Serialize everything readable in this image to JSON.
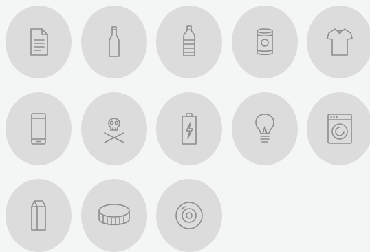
{
  "category_icons": [
    {
      "name": "paper-document",
      "icon": "document-icon"
    },
    {
      "name": "glass-bottle",
      "icon": "glass-bottle-icon"
    },
    {
      "name": "plastic-bottle",
      "icon": "plastic-bottle-icon"
    },
    {
      "name": "tin-can",
      "icon": "tin-can-icon"
    },
    {
      "name": "clothing",
      "icon": "t-shirt-icon"
    },
    {
      "name": "mobile-phone",
      "icon": "smartphone-icon"
    },
    {
      "name": "hazardous-waste",
      "icon": "skull-crossbones-icon"
    },
    {
      "name": "battery",
      "icon": "battery-icon"
    },
    {
      "name": "light-bulb",
      "icon": "light-bulb-icon"
    },
    {
      "name": "washing-machine",
      "icon": "washing-machine-icon"
    },
    {
      "name": "milk-carton",
      "icon": "milk-carton-icon"
    },
    {
      "name": "bottle-cap",
      "icon": "bottle-cap-icon"
    },
    {
      "name": "compact-disc",
      "icon": "cd-icon"
    }
  ],
  "colors": {
    "page_background": "#f4f6f5",
    "tile_background": "#dcdcdc",
    "icon_stroke": "#8d8d8d"
  }
}
